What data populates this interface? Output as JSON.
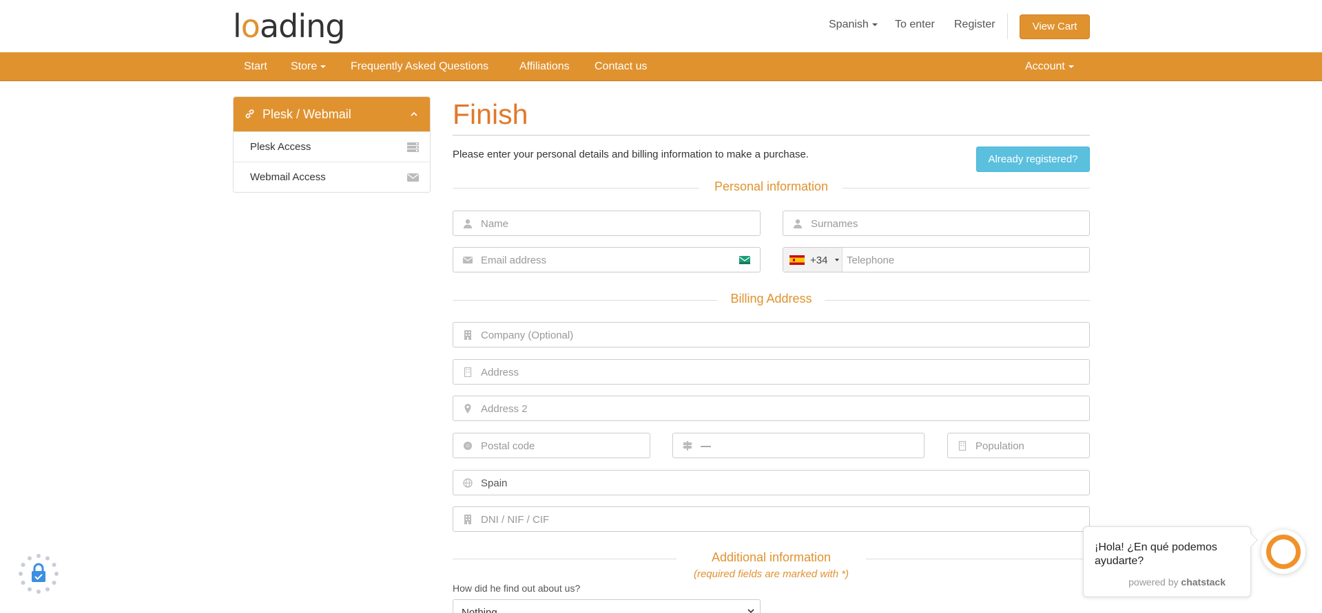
{
  "header": {
    "logo_prefix": "l",
    "logo_o": "o",
    "logo_suffix": "ading",
    "language": "Spanish",
    "login": "To enter",
    "register": "Register",
    "cart": "View Cart"
  },
  "nav": {
    "items": [
      "Start",
      "Store",
      "Frequently Asked Questions",
      "Affiliations",
      "Contact us"
    ],
    "account": "Account"
  },
  "sidebar": {
    "title": "Plesk / Webmail",
    "items": [
      {
        "label": "Plesk Access",
        "icon": "server-icon"
      },
      {
        "label": "Webmail Access",
        "icon": "envelope-icon"
      }
    ]
  },
  "main": {
    "title": "Finish",
    "intro": "Please enter your personal details and billing information to make a purchase.",
    "already_registered": "Already registered?"
  },
  "sections": {
    "personal": "Personal information",
    "billing": "Billing Address",
    "additional": "Additional information",
    "required_note": "(required fields are marked with *)"
  },
  "fields": {
    "name": "Name",
    "surnames": "Surnames",
    "email": "Email address",
    "phone_code": "+34",
    "telephone": "Telephone",
    "company": "Company (Optional)",
    "address": "Address",
    "address2": "Address 2",
    "postal": "Postal code",
    "province": "—",
    "population": "Population",
    "country": "Spain",
    "dni": "DNI / NIF / CIF"
  },
  "referral": {
    "question": "How did he find out about us?",
    "selected": "Nothing"
  },
  "chat": {
    "message": "¡Hola! ¿En qué podemos ayudarte?",
    "powered_prefix": "powered by",
    "powered_brand": "chatstack"
  },
  "colors": {
    "brand": "#e0922f",
    "title": "#e0782a",
    "info_button": "#5bc0de"
  }
}
